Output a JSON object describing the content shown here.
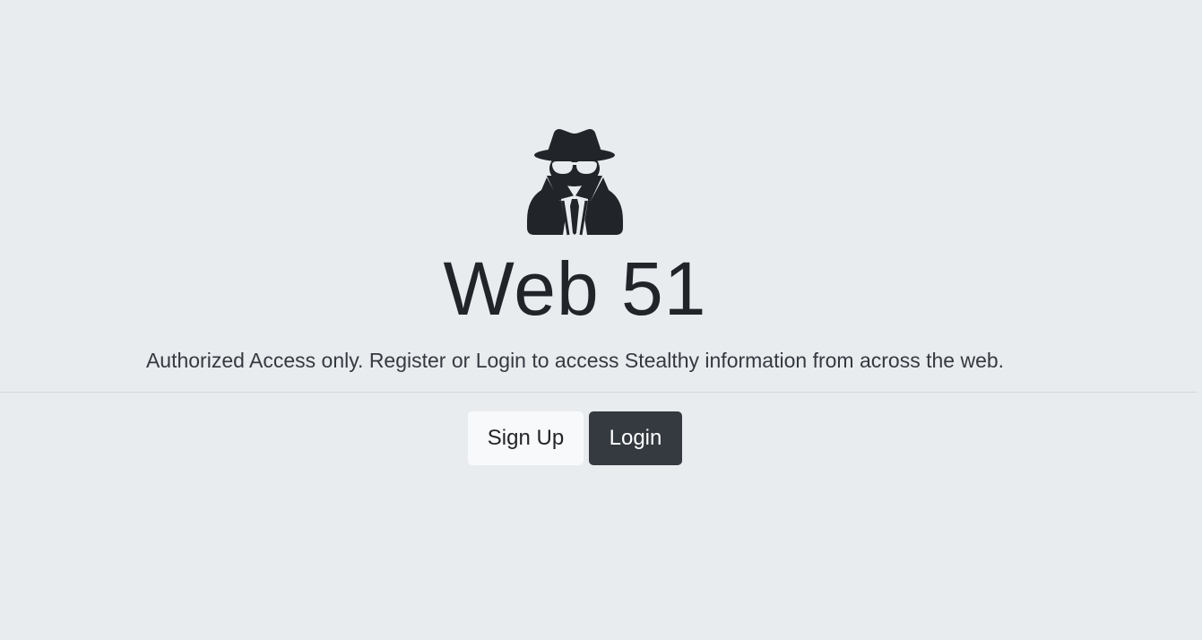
{
  "hero": {
    "icon": "user-secret-icon",
    "title": "Web 51",
    "lead": "Authorized Access only. Register or Login to access Stealthy information from across the web."
  },
  "actions": {
    "signup_label": "Sign Up",
    "login_label": "Login"
  },
  "colors": {
    "background": "#e9ecef",
    "text": "#212529",
    "light_button": "#f8f9fa",
    "dark_button": "#343a40"
  }
}
